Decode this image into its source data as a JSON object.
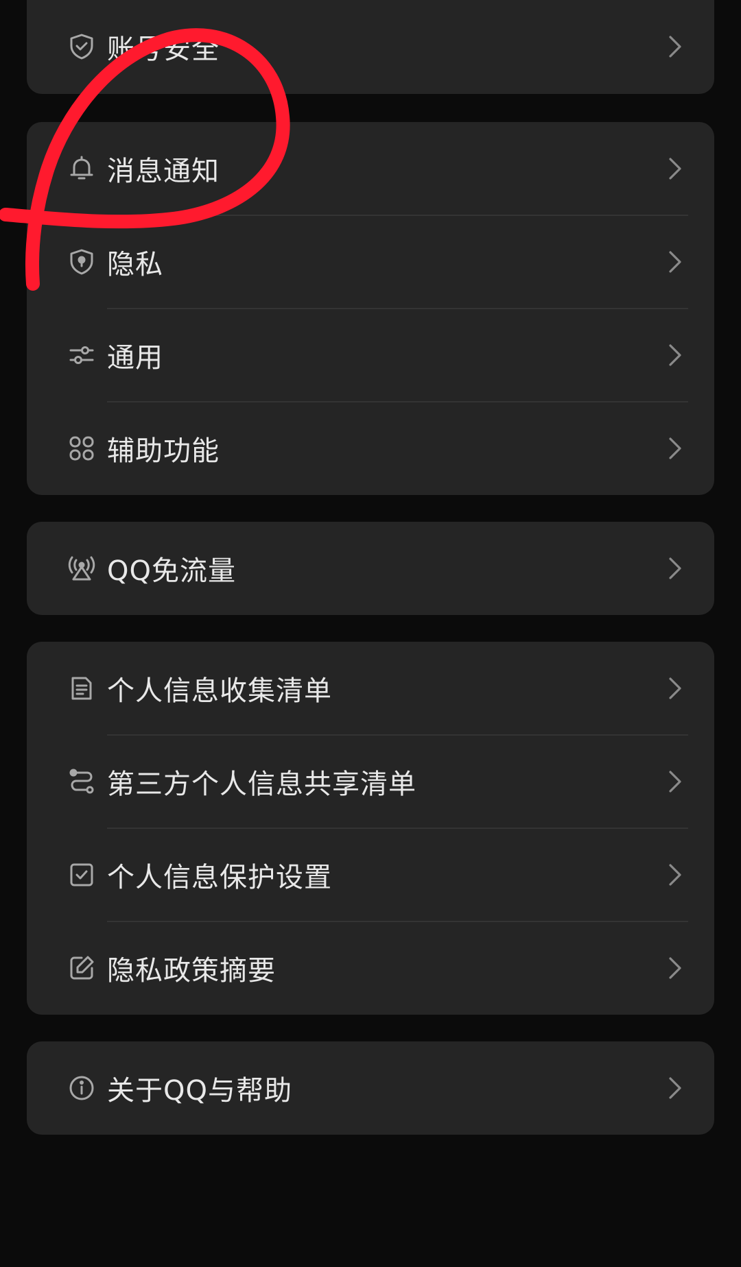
{
  "settings": {
    "card1": {
      "items": [
        {
          "label": "账号安全",
          "icon": "shield-check-icon"
        }
      ]
    },
    "card2": {
      "items": [
        {
          "label": "消息通知",
          "icon": "bell-icon"
        },
        {
          "label": "隐私",
          "icon": "shield-lock-icon"
        },
        {
          "label": "通用",
          "icon": "sliders-icon"
        },
        {
          "label": "辅助功能",
          "icon": "grid-icon"
        }
      ]
    },
    "card3": {
      "items": [
        {
          "label": "QQ免流量",
          "icon": "signal-tower-icon"
        }
      ]
    },
    "card4": {
      "items": [
        {
          "label": "个人信息收集清单",
          "icon": "document-icon"
        },
        {
          "label": "第三方个人信息共享清单",
          "icon": "share-flow-icon"
        },
        {
          "label": "个人信息保护设置",
          "icon": "checkbox-icon"
        },
        {
          "label": "隐私政策摘要",
          "icon": "edit-icon"
        }
      ]
    },
    "card5": {
      "items": [
        {
          "label": "关于QQ与帮助",
          "icon": "info-icon"
        }
      ]
    }
  },
  "colors": {
    "background": "#0b0b0b",
    "card": "#252525",
    "text": "#e8e8e8",
    "icon": "#a8a8a8",
    "chevron": "#8a8a8a",
    "annotation": "#ff1a2e"
  }
}
